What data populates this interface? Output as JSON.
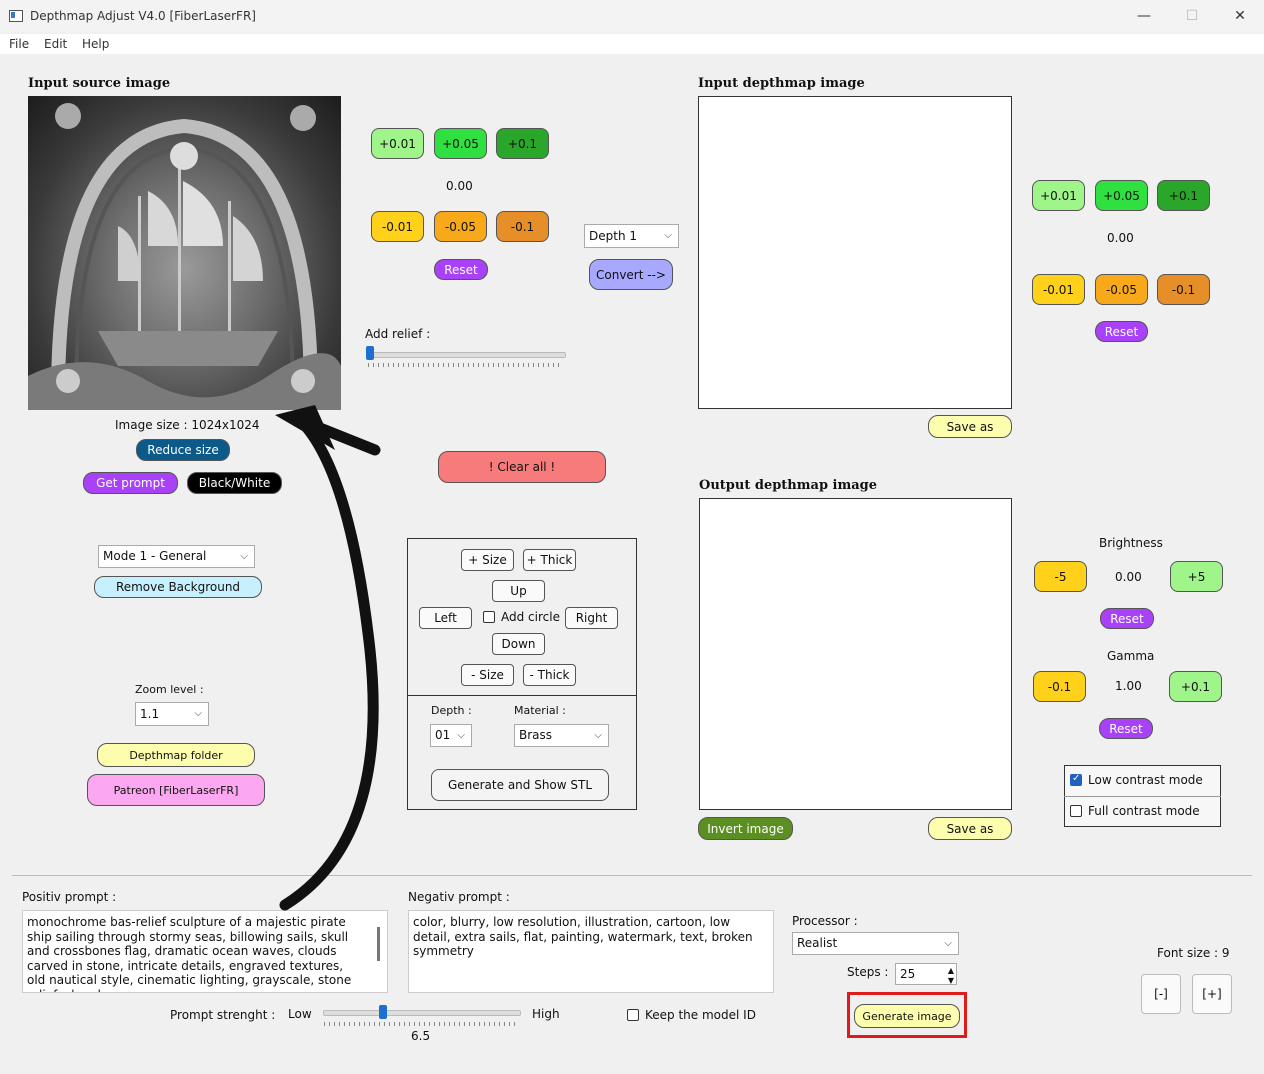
{
  "window": {
    "title": "Depthmap Adjust V4.0 [FiberLaserFR]"
  },
  "menu": [
    "File",
    "Edit",
    "Help"
  ],
  "source": {
    "title": "Input source image",
    "image_size": "Image size : 1024x1024",
    "reduce_size": "Reduce size",
    "get_prompt": "Get prompt",
    "black_white": "Black/White"
  },
  "relief": {
    "plus": [
      "+0.01",
      "+0.05",
      "+0.1"
    ],
    "minus": [
      "-0.01",
      "-0.05",
      "-0.1"
    ],
    "value": "0.00",
    "reset": "Reset",
    "add_relief": "Add relief :",
    "slider_fraction": 0.0
  },
  "convert": {
    "depth_select": "Depth 1",
    "convert_btn": "Convert -->"
  },
  "clear_all": "!   Clear all   !",
  "mode": {
    "select": "Mode 1 - General",
    "remove_bg": "Remove Background"
  },
  "zoom": {
    "label": "Zoom level :",
    "value": "1.1"
  },
  "links": {
    "depthmap_folder": "Depthmap folder",
    "patreon": "Patreon [FiberLaserFR]"
  },
  "circle_panel": {
    "plus_size": "+ Size",
    "plus_thick": "+ Thick",
    "up": "Up",
    "left": "Left",
    "add_circle": "Add circle",
    "right": "Right",
    "down": "Down",
    "minus_size": "- Size",
    "minus_thick": "- Thick",
    "depth_label": "Depth :",
    "depth_value": "01",
    "material_label": "Material :",
    "material_value": "Brass",
    "generate_stl": "Generate and Show STL"
  },
  "input_depth": {
    "title": "Input depthmap image",
    "save_as": "Save as",
    "plus": [
      "+0.01",
      "+0.05",
      "+0.1"
    ],
    "minus": [
      "-0.01",
      "-0.05",
      "-0.1"
    ],
    "value": "0.00",
    "reset": "Reset"
  },
  "output_depth": {
    "title": "Output depthmap image",
    "invert": "Invert image",
    "save_as": "Save as",
    "brightness_label": "Brightness",
    "brightness_minus": "-5",
    "brightness_value": "0.00",
    "brightness_plus": "+5",
    "brightness_reset": "Reset",
    "gamma_label": "Gamma",
    "gamma_minus": "-0.1",
    "gamma_value": "1.00",
    "gamma_plus": "+0.1",
    "gamma_reset": "Reset",
    "low_contrast": "Low contrast mode",
    "full_contrast": "Full contrast mode"
  },
  "prompts": {
    "positive_label": "Positiv prompt :",
    "positive_text": "monochrome bas-relief sculpture of a majestic pirate ship sailing through stormy seas, billowing sails, skull and crossbones flag, dramatic ocean waves, clouds carved in stone, intricate details, engraved textures, old nautical style, cinematic lighting, grayscale, stone relief, zbrush",
    "negative_label": "Negativ prompt :",
    "negative_text": "color, blurry, low resolution, illustration, cartoon, low detail, extra sails, flat, painting, watermark, text, broken symmetry",
    "strength_label": "Prompt strenght :",
    "low": "Low",
    "high": "High",
    "strength_value": "6.5",
    "strength_fraction": 0.31,
    "keep_model": "Keep the model ID"
  },
  "processor": {
    "label": "Processor :",
    "value": "Realist",
    "steps_label": "Steps :",
    "steps_value": "25",
    "generate": "Generate image"
  },
  "font": {
    "label": "Font size : 9",
    "minus": "[-]",
    "plus": "[+]"
  },
  "colors": {
    "highlight_box": "#e01b1b",
    "arrow": "#111111"
  }
}
